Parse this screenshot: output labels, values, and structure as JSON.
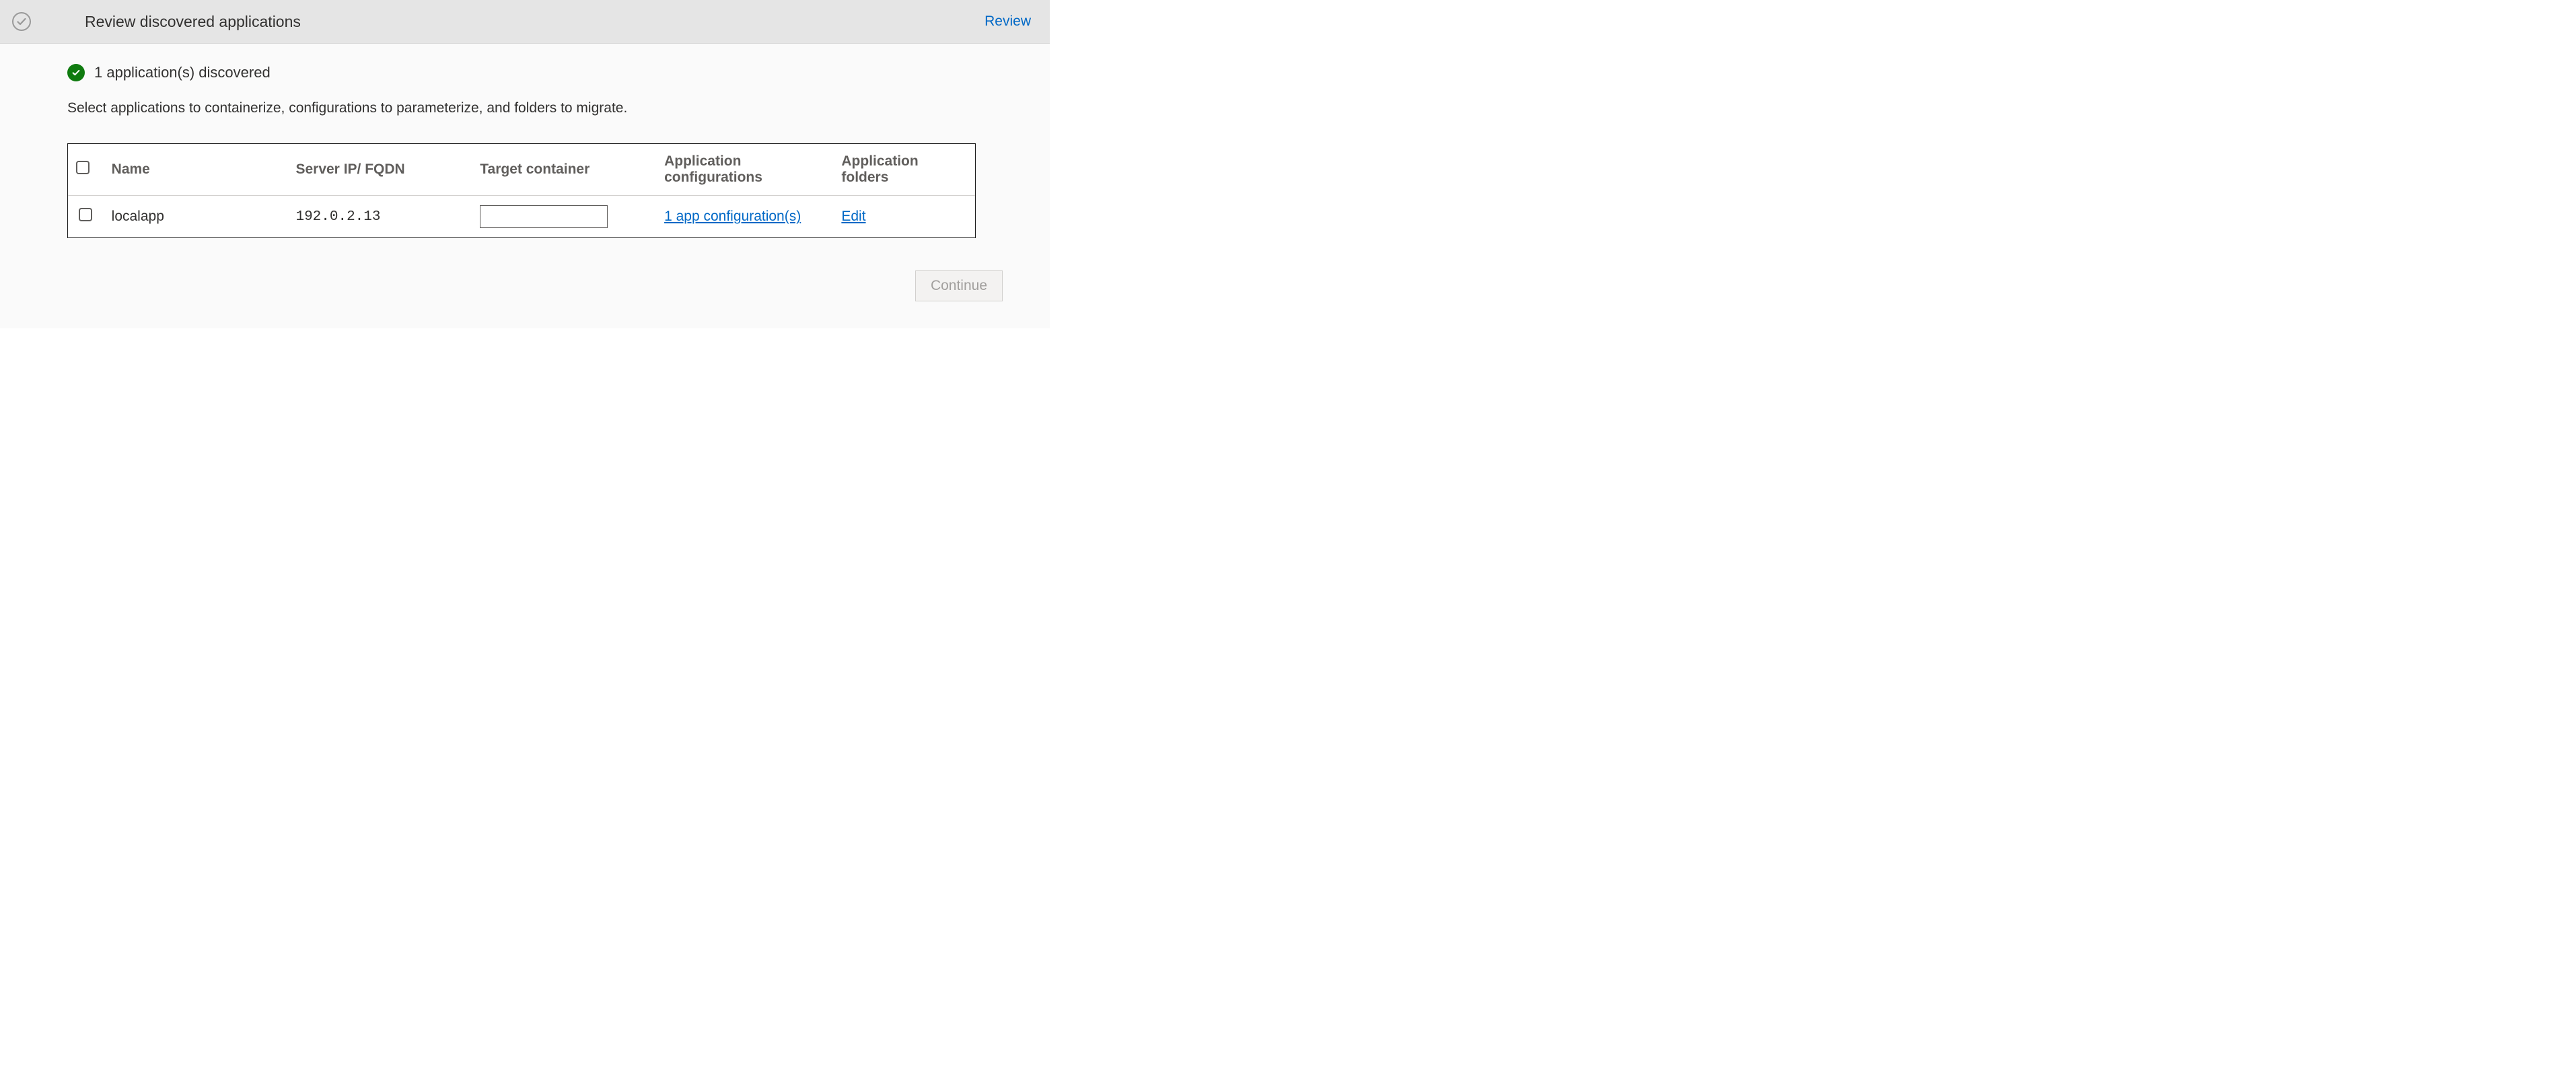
{
  "header": {
    "title": "Review discovered applications",
    "action_label": "Review"
  },
  "status": {
    "message": "1 application(s) discovered"
  },
  "instruction": "Select applications to containerize, configurations to parameterize, and folders to migrate.",
  "table": {
    "headers": {
      "name": "Name",
      "server": "Server IP/ FQDN",
      "target": "Target container",
      "configs": "Application configurations",
      "folders": "Application folders"
    },
    "rows": [
      {
        "name": "localapp",
        "server": "192.0.2.13",
        "target_value": "",
        "config_link": "1 app configuration(s)",
        "folders_link": "Edit"
      }
    ]
  },
  "footer": {
    "continue_label": "Continue"
  }
}
